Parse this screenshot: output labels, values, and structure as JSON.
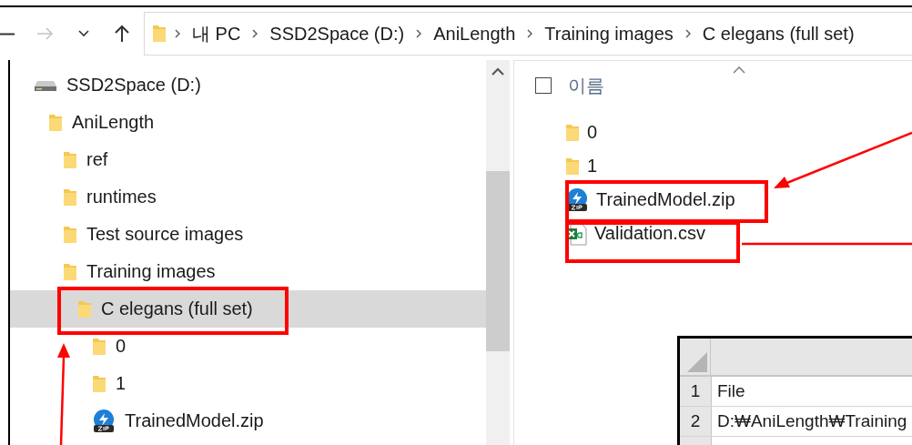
{
  "nav": [
    {
      "kind": "back",
      "disabled": false
    },
    {
      "kind": "forward",
      "disabled": true
    },
    {
      "kind": "recent",
      "disabled": false
    },
    {
      "kind": "up",
      "disabled": false
    }
  ],
  "address": {
    "items": [
      "내 PC",
      "SSD2Space (D:)",
      "AniLength",
      "Training images",
      "C elegans (full set)"
    ]
  },
  "tree": [
    {
      "label": "SSD2Space (D:)",
      "kind": "drive",
      "selected": false,
      "children": [
        {
          "label": "AniLength",
          "kind": "folder",
          "selected": false,
          "children": [
            {
              "label": "ref",
              "kind": "folder",
              "selected": false
            },
            {
              "label": "runtimes",
              "kind": "folder",
              "selected": false
            },
            {
              "label": "Test source images",
              "kind": "folder",
              "selected": false
            },
            {
              "label": "Training images",
              "kind": "folder",
              "selected": false,
              "children": [
                {
                  "label": "C elegans (full set)",
                  "kind": "folder",
                  "selected": true,
                  "children": [
                    {
                      "label": "0",
                      "kind": "folder",
                      "selected": false
                    },
                    {
                      "label": "1",
                      "kind": "folder",
                      "selected": false
                    },
                    {
                      "label": "TrainedModel.zip",
                      "kind": "zip",
                      "selected": false
                    }
                  ]
                }
              ]
            }
          ]
        }
      ]
    }
  ],
  "file_list": {
    "name_header": "이름",
    "select_all_checked": false,
    "items": [
      {
        "label": "0",
        "kind": "folder"
      },
      {
        "label": "1",
        "kind": "folder"
      },
      {
        "label": "TrainedModel.zip",
        "kind": "zip"
      },
      {
        "label": "Validation.csv",
        "kind": "csv"
      }
    ]
  },
  "spreadsheet": {
    "rows": [
      {
        "number": "1",
        "cell": "File"
      },
      {
        "number": "2",
        "cell": "D:₩AniLength₩Training"
      }
    ]
  }
}
